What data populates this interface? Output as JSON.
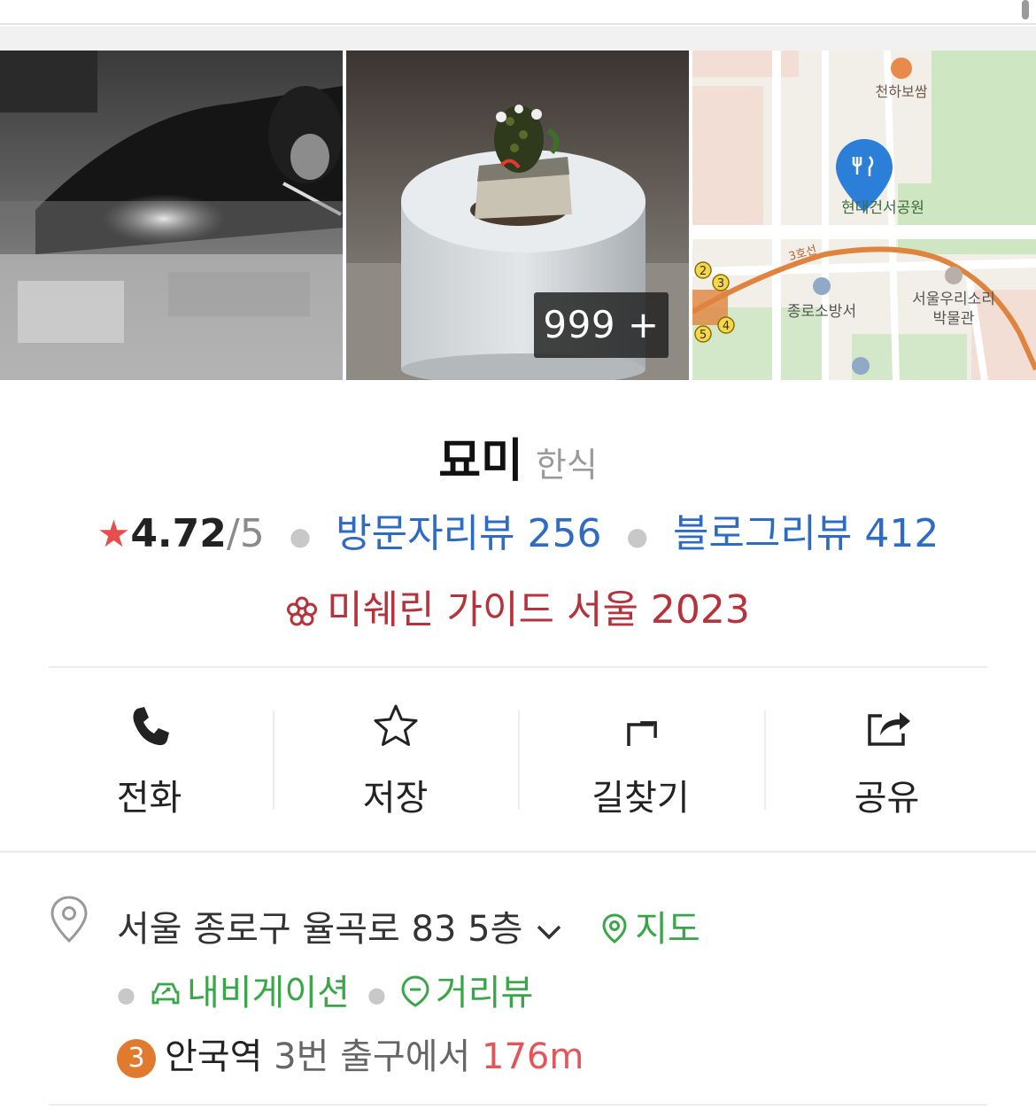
{
  "gallery": {
    "photo_count": "999 +",
    "map_labels": {
      "restaurant_top": "천하보쌈",
      "park": "현대건서공원",
      "line": "3호선",
      "fire_station": "종로소방서",
      "museum_line1": "서울우리소리",
      "museum_line2": "박물관",
      "exit_numbers": [
        "2",
        "3",
        "5",
        "4"
      ]
    }
  },
  "place": {
    "name": "묘미",
    "category": "한식"
  },
  "rating": {
    "score": "4.72",
    "out_of": "/5",
    "visitor_reviews": "방문자리뷰 256",
    "blog_reviews": "블로그리뷰 412"
  },
  "michelin": {
    "text": "미쉐린 가이드 서울 2023"
  },
  "actions": [
    {
      "label": "전화",
      "icon": "phone-icon"
    },
    {
      "label": "저장",
      "icon": "star-outline-icon"
    },
    {
      "label": "길찾기",
      "icon": "directions-icon"
    },
    {
      "label": "공유",
      "icon": "share-icon"
    }
  ],
  "address": {
    "full": "서울 종로구 율곡로 83 5층",
    "map_link": "지도",
    "navigation_link": "내비게이션",
    "street_view_link": "거리뷰"
  },
  "transit": {
    "line_number": "3",
    "station": "안국역",
    "exit": "3번 출구에서",
    "distance": "176m"
  },
  "colors": {
    "link_blue": "#2e6cc4",
    "michelin_red": "#b4333c",
    "green": "#3aa64a",
    "star_red": "#e84d4d",
    "line3_orange": "#e07a2e",
    "distance_red": "#e4555a"
  }
}
